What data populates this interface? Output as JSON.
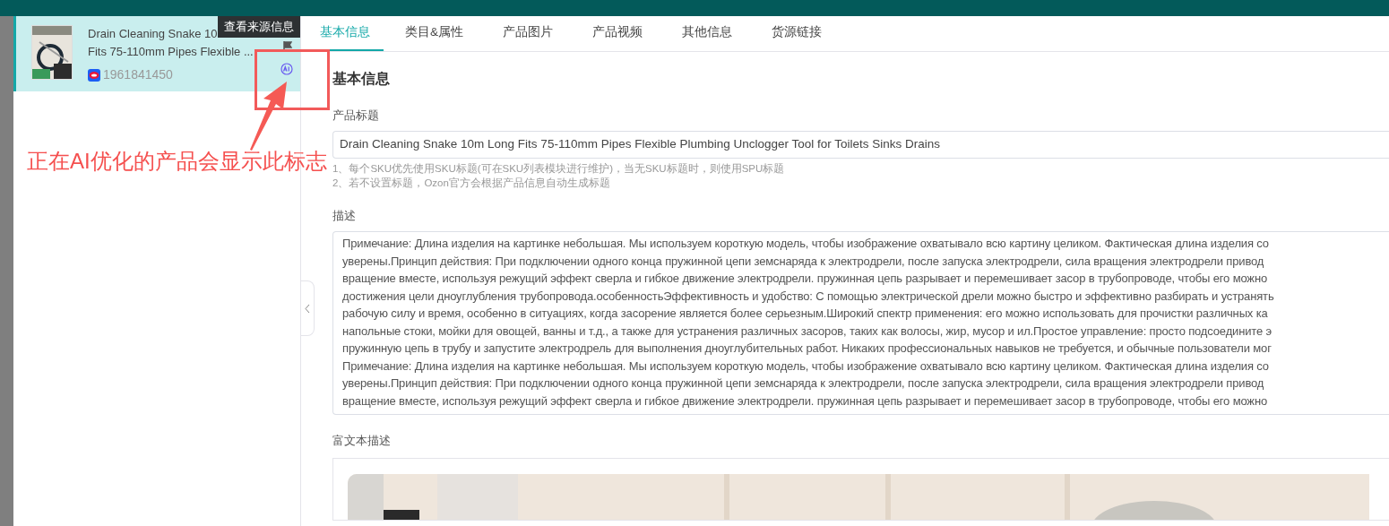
{
  "tooltip": "查看来源信息",
  "product": {
    "title_lines": [
      "Drain Cleaning Snake 10",
      "Fits 75-110mm Pipes Flexible ..."
    ],
    "id": "1961841450",
    "selected": true,
    "ai_optimizing": true,
    "flagged": true
  },
  "tabs": [
    {
      "label": "基本信息",
      "selected": true
    },
    {
      "label": "类目&属性",
      "selected": false
    },
    {
      "label": "产品图片",
      "selected": false
    },
    {
      "label": "产品视频",
      "selected": false
    },
    {
      "label": "其他信息",
      "selected": false
    },
    {
      "label": "货源链接",
      "selected": false
    }
  ],
  "section_title": "基本信息",
  "product_title": {
    "label": "产品标题",
    "value": "Drain Cleaning Snake 10m Long Fits 75-110mm Pipes Flexible Plumbing Unclogger Tool for Toilets Sinks Drains",
    "hints": [
      "1、每个SKU优先使用SKU标题(可在SKU列表模块进行维护)，当无SKU标题时，则使用SPU标题",
      "2、若不设置标题，Ozon官方会根据产品信息自动生成标题"
    ]
  },
  "description": {
    "label": "描述",
    "lines": [
      "Примечание: Длина изделия на картинке небольшая. Мы используем короткую модель, чтобы изображение охватывало всю картину целиком. Фактическая длина изделия со",
      "уверены.Принцип действия: При подключении одного конца пружинной цепи земснаряда к электродрели, после запуска электродрели, сила вращения электродрели привод",
      "вращение вместе, используя режущий эффект сверла и гибкое движение электродрели. пружинная цепь разрывает и перемешивает засор в трубопроводе, чтобы его можно",
      "достижения цели дноуглубления трубопровода.особенностьЭффективность и удобство: С помощью электрической дрели можно быстро и эффективно разбирать и устранять",
      "рабочую силу и время, особенно в ситуациях, когда засорение является более серьезным.Широкий спектр применения: его можно использовать для прочистки различных ка",
      "напольные стоки, мойки для овощей, ванны и т.д., а также для устранения различных засоров, таких как волосы, жир, мусор и ил.Простое управление: просто подсоедините э",
      "пружинную цепь в трубу и запустите электродрель для выполнения дноуглубительных работ. Никаких профессиональных навыков не требуется, и обычные пользователи мог",
      "Примечание: Длина изделия на картинке небольшая. Мы используем короткую модель, чтобы изображение охватывало всю картину целиком. Фактическая длина изделия со",
      "уверены.Принцип действия: При подключении одного конца пружинной цепи земснаряда к электродрели, после запуска электродрели, сила вращения электродрели привод",
      "вращение вместе, используя режущий эффект сверла и гибкое движение электродрели. пружинная цепь разрывает и перемешивает засор в трубопроводе, чтобы его можно"
    ]
  },
  "rich_description": {
    "label": "富文本描述"
  },
  "annotation": "正在AI优化的产品会显示此标志"
}
